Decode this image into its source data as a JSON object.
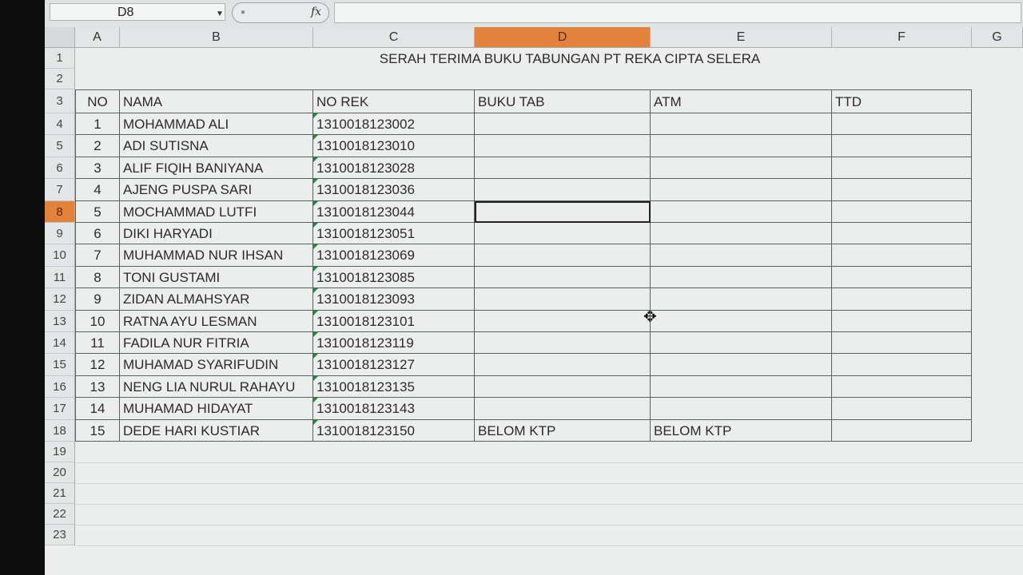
{
  "formula_bar": {
    "name_box": "D8",
    "fx_label": "fx",
    "formula": ""
  },
  "columns": [
    "A",
    "B",
    "C",
    "D",
    "E",
    "F",
    "G"
  ],
  "active_column": "D",
  "title": "SERAH TERIMA BUKU TABUNGAN PT REKA CIPTA SELERA",
  "headers": {
    "no": "NO",
    "nama": "NAMA",
    "no_rek": "NO REK",
    "buku_tab": "BUKU TAB",
    "atm": "ATM",
    "ttd": "TTD"
  },
  "rows": [
    {
      "row": "4",
      "no": "1",
      "nama": "MOHAMMAD ALI",
      "no_rek": "1310018123002",
      "buku_tab": "",
      "atm": ""
    },
    {
      "row": "5",
      "no": "2",
      "nama": "ADI SUTISNA",
      "no_rek": "1310018123010",
      "buku_tab": "",
      "atm": ""
    },
    {
      "row": "6",
      "no": "3",
      "nama": "ALIF FIQIH BANIYANA",
      "no_rek": "1310018123028",
      "buku_tab": "",
      "atm": ""
    },
    {
      "row": "7",
      "no": "4",
      "nama": "AJENG PUSPA SARI",
      "no_rek": "1310018123036",
      "buku_tab": "",
      "atm": ""
    },
    {
      "row": "8",
      "no": "5",
      "nama": "MOCHAMMAD LUTFI",
      "no_rek": "1310018123044",
      "buku_tab": "",
      "atm": ""
    },
    {
      "row": "9",
      "no": "6",
      "nama": "DIKI HARYADI",
      "no_rek": "1310018123051",
      "buku_tab": "",
      "atm": ""
    },
    {
      "row": "10",
      "no": "7",
      "nama": "MUHAMMAD NUR IHSAN",
      "no_rek": "1310018123069",
      "buku_tab": "",
      "atm": ""
    },
    {
      "row": "11",
      "no": "8",
      "nama": "TONI GUSTAMI",
      "no_rek": "1310018123085",
      "buku_tab": "",
      "atm": ""
    },
    {
      "row": "12",
      "no": "9",
      "nama": "ZIDAN ALMAHSYAR",
      "no_rek": "1310018123093",
      "buku_tab": "",
      "atm": ""
    },
    {
      "row": "13",
      "no": "10",
      "nama": "RATNA AYU LESMAN",
      "no_rek": "1310018123101",
      "buku_tab": "",
      "atm": ""
    },
    {
      "row": "14",
      "no": "11",
      "nama": "FADILA NUR FITRIA",
      "no_rek": "1310018123119",
      "buku_tab": "",
      "atm": ""
    },
    {
      "row": "15",
      "no": "12",
      "nama": "MUHAMAD SYARIFUDIN",
      "no_rek": "1310018123127",
      "buku_tab": "",
      "atm": ""
    },
    {
      "row": "16",
      "no": "13",
      "nama": "NENG LIA NURUL RAHAYU",
      "no_rek": "1310018123135",
      "buku_tab": "",
      "atm": ""
    },
    {
      "row": "17",
      "no": "14",
      "nama": "MUHAMAD HIDAYAT",
      "no_rek": "1310018123143",
      "buku_tab": "",
      "atm": ""
    },
    {
      "row": "18",
      "no": "15",
      "nama": "DEDE HARI KUSTIAR",
      "no_rek": "1310018123150",
      "buku_tab": "BELOM KTP",
      "atm": "BELOM KTP"
    }
  ],
  "header_rows": [
    "1",
    "2",
    "3"
  ],
  "empty_rows": [
    "19",
    "20",
    "21",
    "22",
    "23"
  ],
  "selected_row": "8",
  "icons": {
    "cursor": "move-cursor-icon"
  },
  "colors": {
    "active_header": "#e3823c",
    "sheet_bg": "#eceeee",
    "account_marker": "#1f8a3d"
  }
}
